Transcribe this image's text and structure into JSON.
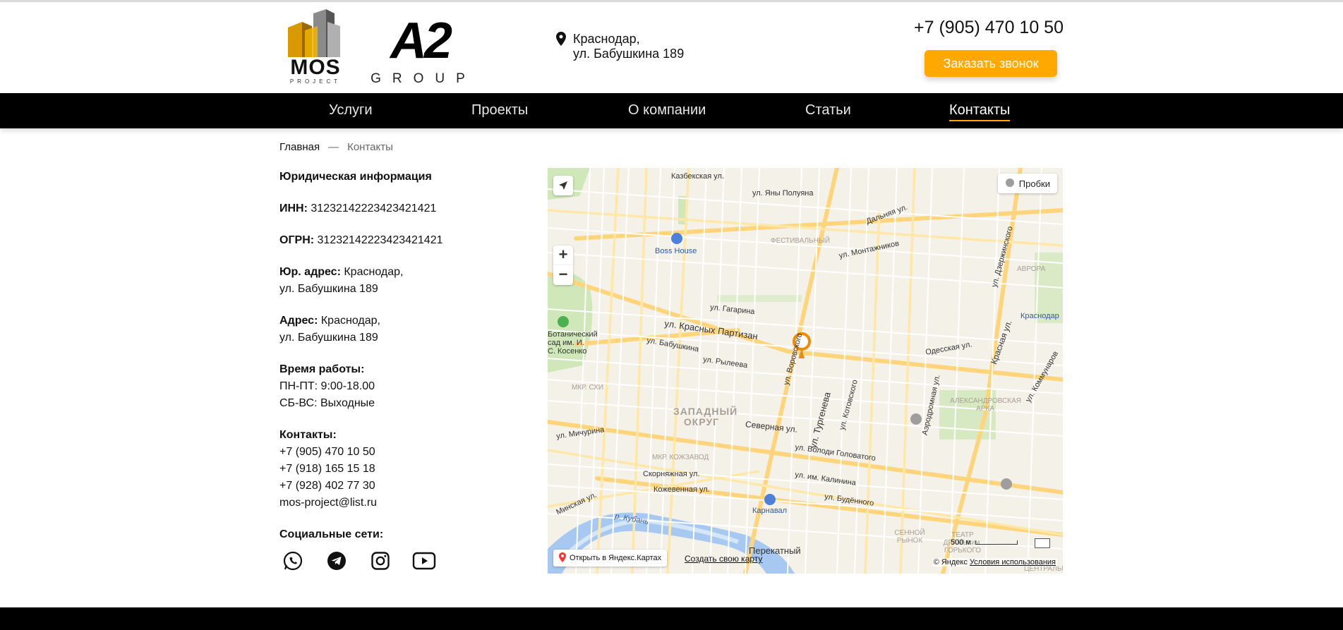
{
  "header": {
    "logo_mos": {
      "word": "MOS",
      "sub": "PROJECT"
    },
    "logo_a2": {
      "mark": "A2",
      "sub": "GROUP"
    },
    "address": [
      "Краснодар,",
      "ул. Бабушкина 189"
    ],
    "phone": "+7 (905) 470 10 50",
    "call_button": "Заказать звонок",
    "accent_color": "#ffa800"
  },
  "nav": {
    "items": [
      {
        "label": "Услуги"
      },
      {
        "label": "Проекты"
      },
      {
        "label": "О компании"
      },
      {
        "label": "Статьи"
      },
      {
        "label": "Контакты",
        "active": true
      }
    ]
  },
  "breadcrumb": {
    "home": "Главная",
    "separator": "—",
    "current": "Контакты"
  },
  "info": {
    "legal_heading": "Юридическая информация",
    "inn_label": "ИНН:",
    "inn_value": "31232142223423421421",
    "ogrn_label": "ОГРН:",
    "ogrn_value": "31232142223423421421",
    "legal_address_label": "Юр. адрес:",
    "legal_address_line1": "Краснодар,",
    "legal_address_line2": "ул. Бабушкина 189",
    "address_label": "Адрес:",
    "address_line1": "Краснодар,",
    "address_line2": "ул. Бабушкина 189",
    "hours_heading": "Время работы:",
    "hours_weekdays": "ПН-ПТ: 9:00-18.00",
    "hours_weekend": "СБ-ВС: Выходные",
    "contacts_heading": "Контакты:",
    "phones": [
      "+7 (905) 470 10 50",
      "+7 (918) 165 15 18",
      "+7 (928) 402 77 30"
    ],
    "email": "mos-project@list.ru",
    "socials_heading": "Социальные сети:",
    "socials": [
      "whatsapp-icon",
      "telegram-icon",
      "instagram-icon",
      "youtube-icon"
    ]
  },
  "map": {
    "traffic": "Пробки",
    "open_yandex": "Открыть в Яндекс.Картах",
    "create_map": "Создать свою карту",
    "copyright": "© Яндекс",
    "terms": "Условия использования",
    "scale": "500 м",
    "labels": {
      "kazbek": "Казбекская ул.",
      "yana_poluyana": "ул. Яны Полуяна",
      "dalnyaya": "Дальняя ул.",
      "festivalny": "ФЕСТИВАЛЬНЫЙ",
      "montazhnikov": "ул. Монтажников",
      "dzerzhinskogo": "ул. Дзержинского",
      "boss_house": "Boss House",
      "avrora": "АВРОРА",
      "gagarina": "ул. Гагарина",
      "krasnyh_partizan": "ул. Красных Партизан",
      "babushkina": "ул. Бабушкина",
      "botanical": "Ботанический сад им. И. С. Косенко",
      "krasnodar": "Краснодар",
      "odesskaya": "Одесская ул.",
      "krasnaya": "Красная ул.",
      "rylеeva": "ул. Рылеева",
      "turgeneva": "ул. Тургенева",
      "vorovskogo": "ул. Воровского",
      "kotovskogo": "ул. Котовского",
      "aerodromnaya": "Аэродромная ул.",
      "aleksandrovskaya": "АЛЕКСАНДРОВСКАЯ АРКА",
      "mkr_shi": "МКР. СХИ",
      "zapadny": "ЗАПАДНЫЙ ОКРУГ",
      "severnaya": "Северная ул.",
      "michurina": "ул. Мичурина",
      "mkr_kozhzavod": "МКР. КОЖЗАВОД",
      "volodi_golovatogo": "ул. Володи Головатого",
      "skornyazhnaya": "Скорняжная ул.",
      "kalinina": "ул. им. Калинина",
      "kozhevennaya": "Кожевенная ул.",
      "budennogo": "ул. Будённого",
      "minskaya": "Минская ул.",
      "karnaval": "Карнавал",
      "r_kuban": "р. Кубань",
      "senoy_rynok": "СЕННОЙ РЫНОК",
      "teatr_dramy": "ТЕАТР ДРАМЫ им. ГОРЬКОГО",
      "perekatny": "Перекатный",
      "centralny": "ЦЕНТРАЛЬНЫ",
      "kommunarov": "ул. Коммунаров"
    }
  }
}
